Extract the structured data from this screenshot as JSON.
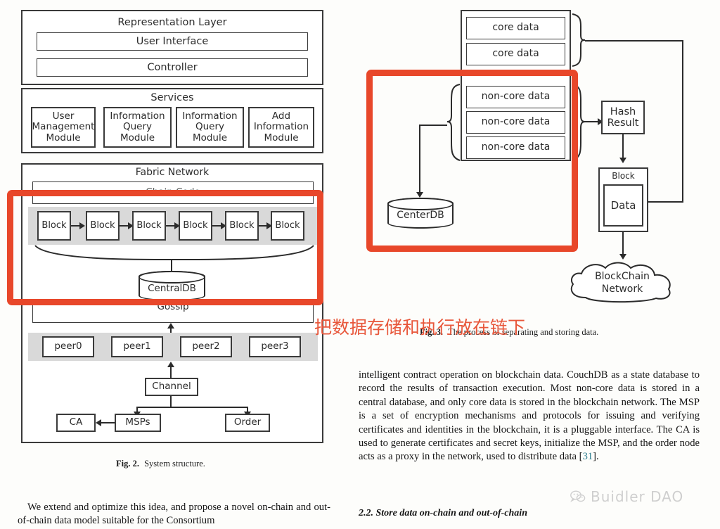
{
  "document": {
    "page_background": "#fdfdfb",
    "annotation_color": "#e8472a"
  },
  "fig2": {
    "caption_prefix": "Fig. 2.",
    "caption_text": "System structure.",
    "layers": [
      {
        "title": "Representation Layer",
        "rows": [
          "User Interface",
          "Controller"
        ]
      },
      {
        "title": "Services",
        "modules": [
          "User\nManagement\nModule",
          "Information\nQuery\nModule",
          "Information\nQuery\nModule",
          "Add\nInformation\nModule"
        ]
      },
      {
        "title": "Fabric Network",
        "chaincode_label": "Chain Code",
        "blocks": [
          "Block",
          "Block",
          "Block",
          "Block",
          "Block",
          "Block"
        ],
        "database": "CentralDB",
        "gossip_label": "Gossip",
        "peers": [
          "peer0",
          "peer1",
          "peer2",
          "peer3"
        ],
        "channel": "Channel",
        "msps": "MSPs",
        "ca": "CA",
        "order": "Order"
      }
    ]
  },
  "fig3": {
    "caption_prefix": "Fig. 3.",
    "caption_text": "The process of separating and storing data.",
    "core_data": [
      "core data",
      "core data"
    ],
    "non_core_data": [
      "non-core data",
      "non-core data",
      "non-core data"
    ],
    "hash_result": "Hash\nResult",
    "hash_result_line1": "Hash",
    "hash_result_line2": "Result",
    "block_label": "Block",
    "data_label": "Data",
    "blockchain_network_line1": "BlockChain",
    "blockchain_network_line2": "Network",
    "center_db": "CenterDB"
  },
  "annotations": {
    "chinese_note": "把数据存储和执行放在链下"
  },
  "article": {
    "right_column_paragraph": "intelligent contract operation on blockchain data. CouchDB as a state database to record the results of transaction execution. Most non-core data is stored in a central database, and only core data is stored in the blockchain network. The MSP is a set of encryption mechanisms and protocols for issuing and verifying certificates and identities in the blockchain, it is a pluggable interface. The CA is used to generate certificates and secret keys, initialize the MSP, and the order node acts as a proxy in the network, used to distribute data [31].",
    "right_column_paragraph_before_cite": "intelligent contract operation on blockchain data. CouchDB as a state database to record the results of transaction execution. Most non-core data is stored in a central database, and only core data is stored in the blockchain network. The MSP is a set of encryption mechanisms and protocols for issuing and verifying certificates and identities in the blockchain, it is a pluggable interface. The CA is used to generate certificates and secret keys, initialize the MSP, and the order node acts as a proxy in the network, used to distribute data [",
    "citation_number": "31",
    "right_column_paragraph_after_cite": "].",
    "section_heading": "2.2. Store data on-chain and out-of-chain",
    "left_column_paragraph": "We extend and optimize this idea, and propose a novel on-chain and out-of-chain data model suitable for the Consortium"
  },
  "watermark": {
    "text": "Buidler DAO",
    "icon": "wechat-icon"
  }
}
